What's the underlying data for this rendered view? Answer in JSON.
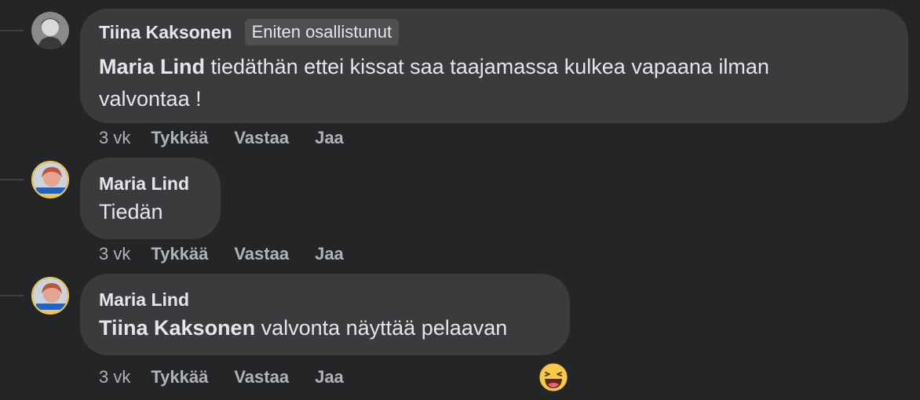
{
  "comments": [
    {
      "author": "Tiina Kaksonen",
      "badge": "Eniten osallistunut",
      "mention": "Maria Lind",
      "text_line1": " tiedäthän ettei kissat saa taajamassa kulkea vapaana ilman",
      "text_line2": "valvontaa !",
      "time": "3 vk",
      "actions": [
        "Tykkää",
        "Vastaa",
        "Jaa"
      ],
      "avatar_icon": "profile-photo-icon"
    },
    {
      "author": "Maria Lind",
      "text": "Tiedän",
      "time": "3 vk",
      "actions": [
        "Tykkää",
        "Vastaa",
        "Jaa"
      ],
      "avatar_icon": "profile-photo-icon"
    },
    {
      "author": "Maria Lind",
      "mention": "Tiina Kaksonen",
      "text": " valvonta näyttää pelaavan",
      "time": "3 vk",
      "actions": [
        "Tykkää",
        "Vastaa",
        "Jaa"
      ],
      "avatar_icon": "profile-photo-icon",
      "reaction_icon": "haha-emoji-icon"
    }
  ],
  "colors": {
    "background": "#242526",
    "bubble": "#3a3b3c",
    "text": "#e4e6eb",
    "secondary_text": "#b0b3b8"
  }
}
